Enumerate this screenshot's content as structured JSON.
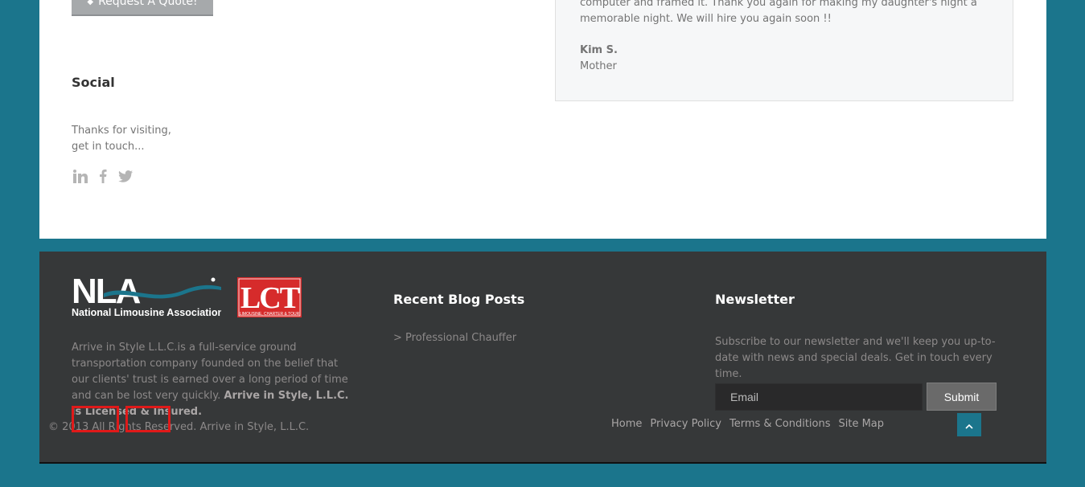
{
  "content": {
    "quote_button_label": "Request A Quote!",
    "social": {
      "title": "Social",
      "text_line1": "Thanks for visiting,",
      "text_line2": "get in touch...",
      "icons": [
        "linkedin-icon",
        "facebook-icon",
        "twitter-icon"
      ]
    },
    "testimonial": {
      "text": "computer and framed it. Thank you again for making my daughter's night a memorable night. We will hire you again soon !!",
      "author": "Kim S.",
      "role": "Mother"
    }
  },
  "footer": {
    "logos": {
      "nla_name": "National Limousine Association",
      "nla_letters": "NLA",
      "lct_letters": "LCT",
      "lct_subtitle": "LIMOUSINE, CHARTER & TOUR"
    },
    "about": {
      "text": "Arrive in Style L.L.C.is a full-service ground transportation company founded on the belief that our clients' trust is earned over a long period of time and can be lost very quickly.",
      "bold": "Arrive in Style, L.L.C. is Licensed & Insured."
    },
    "blog": {
      "title": "Recent Blog Posts",
      "link": "> Professional Chauffer"
    },
    "newsletter": {
      "title": "Newsletter",
      "text": "Subscribe to our newsletter and we'll keep you up-to-date with news and special deals. Get in touch every time.",
      "email_placeholder": "Email",
      "submit_label": "Submit"
    },
    "copyright": "© 2013 All Rights Reserved. Arrive in Style, L.L.C.",
    "nav": [
      "Home",
      "Privacy Policy",
      "Terms & Conditions",
      "Site Map"
    ],
    "to_top_icon": "chevron-up-icon"
  },
  "colors": {
    "page_background": "#1b758c",
    "footer_background": "#363839",
    "highlight": "#e01919"
  }
}
